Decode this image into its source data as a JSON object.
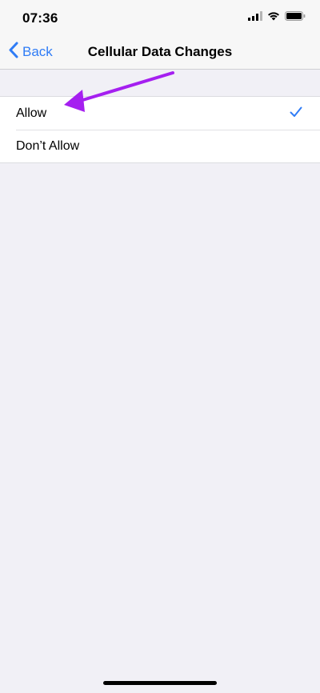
{
  "status_bar": {
    "time": "07:36",
    "icons": [
      "signal-icon",
      "wifi-icon",
      "battery-icon"
    ]
  },
  "nav": {
    "back_label": "Back",
    "title": "Cellular Data Changes"
  },
  "options": [
    {
      "label": "Allow",
      "selected": true
    },
    {
      "label": "Don’t Allow",
      "selected": false
    }
  ],
  "colors": {
    "accent": "#2f7cf6",
    "annotation": "#a51ff0",
    "background": "#f1f0f6"
  }
}
